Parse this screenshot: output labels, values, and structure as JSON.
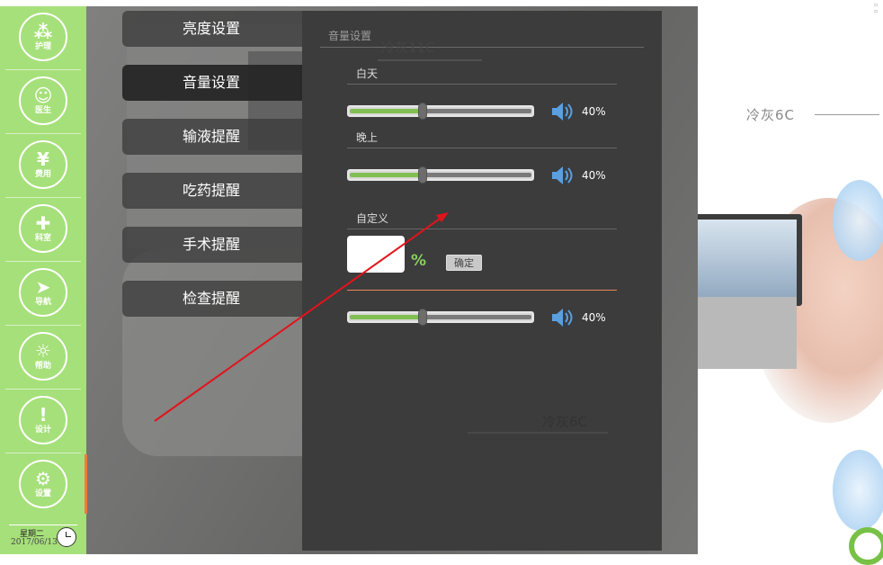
{
  "sidebar": {
    "items": [
      {
        "label": "护理",
        "icon": "nursing-icon",
        "glyph": "⁂"
      },
      {
        "label": "医生",
        "icon": "doctor-icon",
        "glyph": "☺"
      },
      {
        "label": "费用",
        "icon": "yuan-icon",
        "glyph": "¥"
      },
      {
        "label": "科室",
        "icon": "department-icon",
        "glyph": "✚"
      },
      {
        "label": "导航",
        "icon": "navigation-icon",
        "glyph": "➤"
      },
      {
        "label": "帮助",
        "icon": "help-icon",
        "glyph": "☼"
      },
      {
        "label": "设计",
        "icon": "shield-icon",
        "glyph": "!"
      },
      {
        "label": "设置",
        "icon": "gear-icon",
        "glyph": "⚙"
      }
    ],
    "weekday": "星期二",
    "date": "2017/06/13"
  },
  "menu": {
    "items": [
      {
        "label": "亮度设置"
      },
      {
        "label": "音量设置"
      },
      {
        "label": "输液提醒"
      },
      {
        "label": "吃药提醒"
      },
      {
        "label": "手术提醒"
      },
      {
        "label": "检查提醒"
      }
    ],
    "active": "音量设置"
  },
  "volume_panel": {
    "title": "音量设置",
    "day": {
      "label": "白天",
      "value": 40,
      "percent_text": "40%"
    },
    "night": {
      "label": "晚上",
      "value": 40,
      "percent_text": "40%"
    },
    "custom": {
      "label": "自定义",
      "input_value": "",
      "unit": "%",
      "confirm_label": "确定"
    },
    "extra": {
      "value": 40,
      "percent_text": "40%"
    }
  },
  "annotations": {
    "label_11c": "冷灰11C",
    "label_6c_bottom": "冷灰6C",
    "label_6c_right": "冷灰6C"
  },
  "colors": {
    "sidebar_green": "#a6e07a",
    "slider_fill": "#82bf52",
    "accent_orange": "#f07a3a",
    "arrow_red": "#e3131b",
    "speaker_blue": "#5a9fe0"
  }
}
